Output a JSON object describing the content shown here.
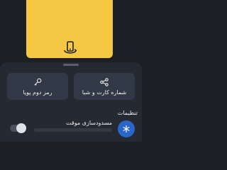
{
  "card": {
    "color": "#f4c842",
    "rotate_icon": "rotate-phone-icon"
  },
  "actions": {
    "share_label": "شماره کارت و شبا",
    "share_icon": "share-icon",
    "otp_label": "رمز دوم پویا",
    "otp_icon": "key-icon"
  },
  "settings": {
    "section_title": "تنظیمات",
    "items": [
      {
        "title": "مسدودسازی موقت",
        "icon": "snowflake-icon",
        "icon_color": "#2a66c8",
        "toggle_on": false
      }
    ]
  }
}
